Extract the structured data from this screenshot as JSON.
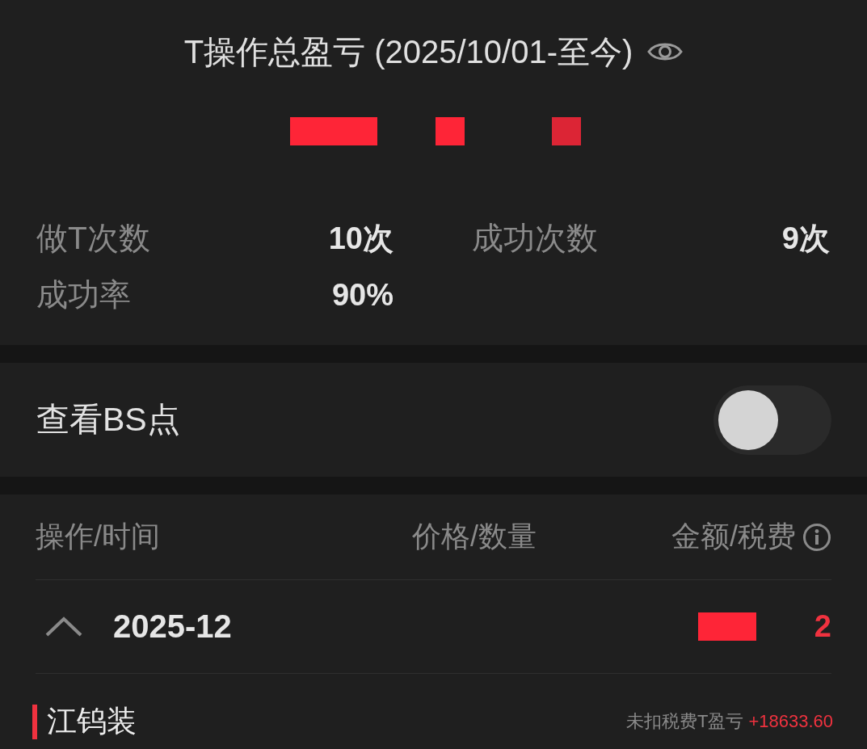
{
  "header": {
    "title": "T操作总盈亏 (2025/10/01-至今)"
  },
  "stats": [
    {
      "label": "做T次数",
      "value": "10次"
    },
    {
      "label": "成功次数",
      "value": "9次"
    },
    {
      "label": "成功率",
      "value": "90%"
    }
  ],
  "bs_points": {
    "label": "查看BS点",
    "on": false
  },
  "table": {
    "columns": [
      "操作/时间",
      "价格/数量",
      "金额/税费"
    ],
    "groups": [
      {
        "month": "2025-12",
        "expanded": true,
        "total": "2",
        "items": [
          {
            "name": "江钨装",
            "pnl_label": "未扣税费T盈亏",
            "pnl_value": "+18633.60"
          }
        ]
      }
    ]
  }
}
